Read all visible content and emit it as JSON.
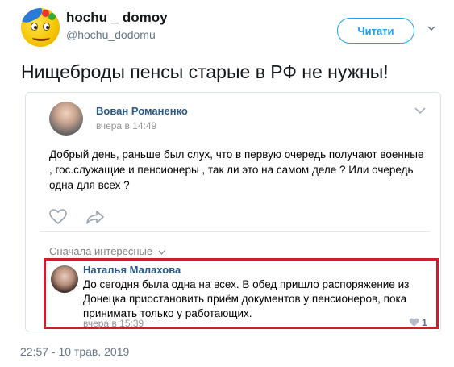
{
  "user": {
    "display_name": "hochu _ domoy",
    "handle": "@hochu_dodomu",
    "avatar_icon": "smiley-avatar"
  },
  "follow_label": "Читати",
  "tweet_text": "Нищеброды пенсы старые в РФ не нужны!",
  "embedded_post": {
    "author": "Вован Романенко",
    "time": "вчера в 14:49",
    "body": "Добрый день, раньше был слух, что в первую очередь получают военные , гос.служащие и пенсионеры , так ли это на самом деле ? Или очередь одна для всех ?",
    "sort_label": "Сначала интересные",
    "comment": {
      "author": "Наталья Малахова",
      "text": "До сегодня была одна на всех. В обед пришло распоряжение из Донецка приостановить приём документов у пенсионеров, пока принимать только у работающих.",
      "time": "вчера в 15:39",
      "likes": "1"
    }
  },
  "timestamp": "22:57 - 10 трав. 2019",
  "colors": {
    "twitter_blue": "#1da1f2",
    "vk_link": "#2a5885",
    "highlight_border": "#cc1e2d"
  }
}
